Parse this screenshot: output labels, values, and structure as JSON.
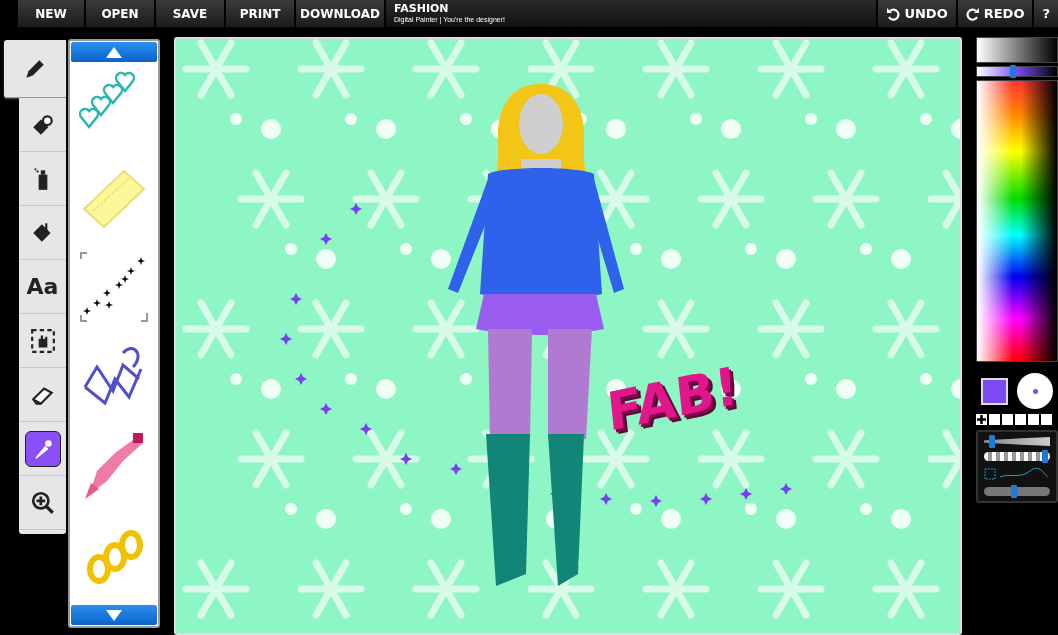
{
  "menu": [
    {
      "label": "NEW"
    },
    {
      "label": "OPEN"
    },
    {
      "label": "SAVE"
    },
    {
      "label": "PRINT"
    },
    {
      "label": "DOWNLOAD"
    }
  ],
  "app": {
    "title": "FASHION",
    "subtitle": "Digital Painter | You're the designer!"
  },
  "history": [
    {
      "kind": "undo",
      "label": "UNDO"
    },
    {
      "kind": "redo",
      "label": "REDO"
    },
    {
      "kind": "help",
      "label": "?"
    }
  ],
  "tools": [
    {
      "kind": "pencil",
      "selected": true,
      "highlighted": false
    },
    {
      "kind": "stamp",
      "selected": false,
      "highlighted": false
    },
    {
      "kind": "spray",
      "selected": false,
      "highlighted": false
    },
    {
      "kind": "fill",
      "selected": false,
      "highlighted": false
    },
    {
      "kind": "text",
      "label": "Aa",
      "selected": false,
      "highlighted": false
    },
    {
      "kind": "move",
      "selected": false,
      "highlighted": false
    },
    {
      "kind": "eraser",
      "selected": false,
      "highlighted": false
    },
    {
      "kind": "dropper",
      "selected": false,
      "highlighted": true
    },
    {
      "kind": "zoom",
      "selected": false,
      "highlighted": false
    }
  ],
  "stamps": [
    {
      "kind": "hearts"
    },
    {
      "kind": "lace"
    },
    {
      "kind": "sparkles"
    },
    {
      "kind": "laces"
    },
    {
      "kind": "braid"
    },
    {
      "kind": "curls"
    }
  ],
  "canvas": {
    "caption": "FAB!"
  },
  "color": {
    "shade": {
      "level": 0.45
    },
    "palette": [
      {
        "filled": false
      },
      {
        "filled": false
      },
      {
        "filled": false
      },
      {
        "filled": false
      },
      {
        "filled": false
      }
    ]
  },
  "brush": {
    "size": {
      "level": 0.12
    },
    "opacity": {
      "level": 0.97
    },
    "smoothing": {
      "level": 0.45
    }
  }
}
